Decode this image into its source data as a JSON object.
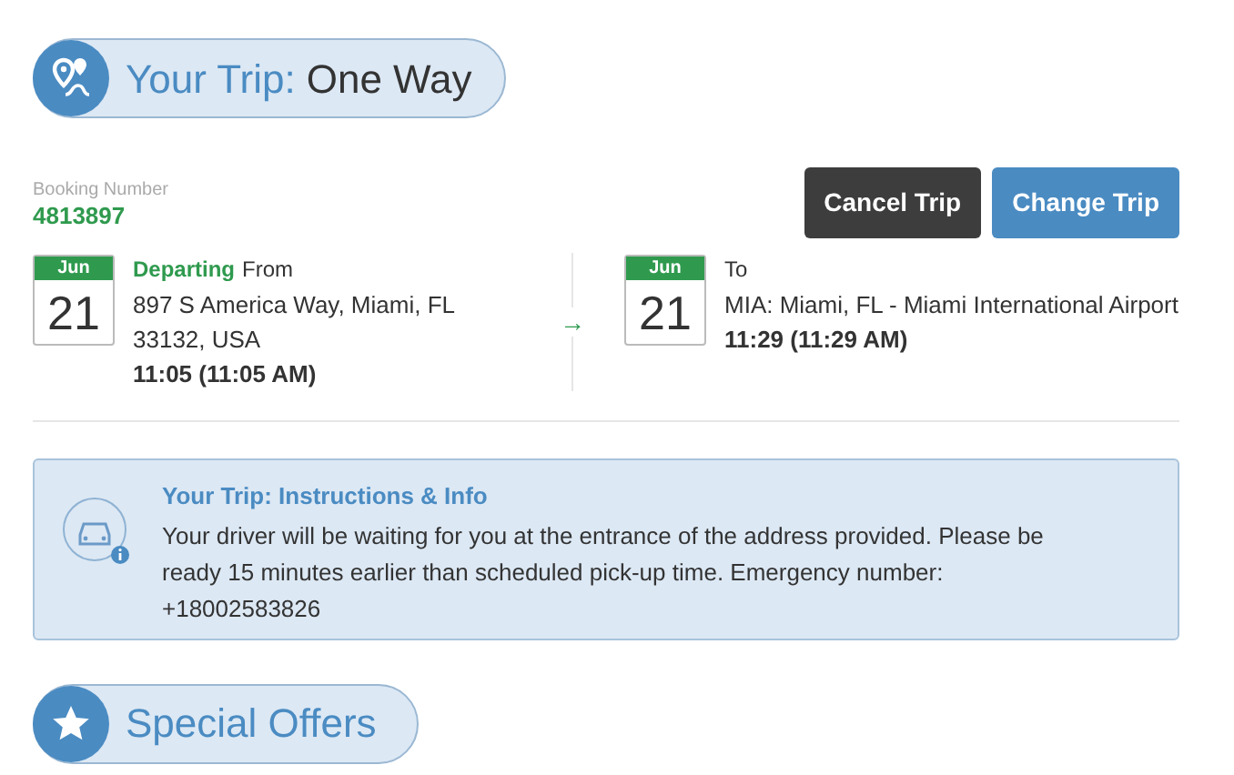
{
  "header": {
    "label": "Your Trip:",
    "value": "One Way"
  },
  "booking": {
    "label": "Booking Number",
    "number": "4813897"
  },
  "buttons": [
    {
      "label": "Cancel Trip",
      "kind": "dark"
    },
    {
      "label": "Change Trip",
      "kind": "primary"
    }
  ],
  "legs": [
    {
      "month": "Jun",
      "day": "21",
      "tag": "Departing",
      "label": "From",
      "address": "897 S America Way, Miami, FL 33132, USA",
      "time": "11:05 (11:05 AM)"
    },
    {
      "month": "Jun",
      "day": "21",
      "label": "To",
      "address": "MIA: Miami, FL - Miami International Airport",
      "time": "11:29 (11:29 AM)"
    }
  ],
  "arrow": "→",
  "info": {
    "title": "Your Trip: Instructions & Info",
    "text": "Your driver will be waiting for you at the entrance of the address provided. Please be ready 15 minutes earlier than scheduled pick-up time. Emergency number: +18002583826"
  },
  "section": {
    "title": "Special Offers"
  }
}
